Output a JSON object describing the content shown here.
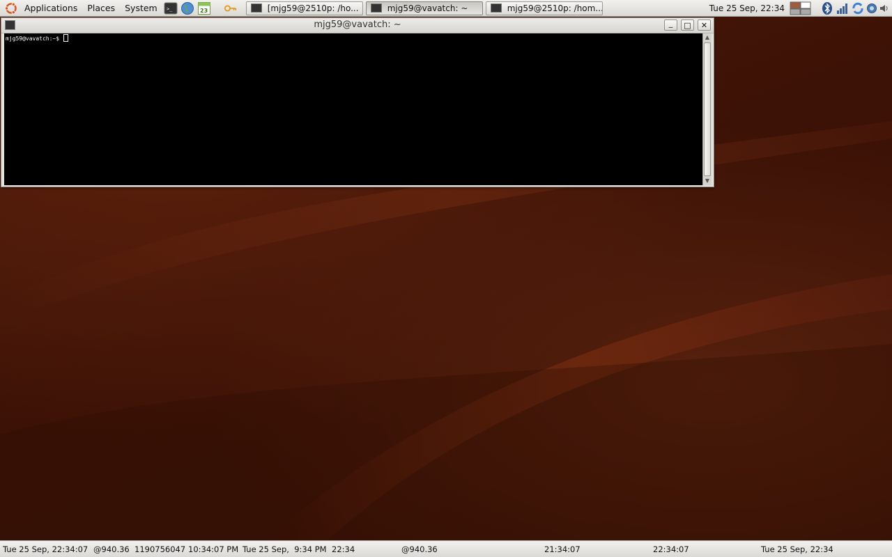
{
  "top_panel": {
    "menus": [
      "Applications",
      "Places",
      "System"
    ],
    "tasks": [
      {
        "label": "[mjg59@2510p: /ho...",
        "active": false
      },
      {
        "label": "mjg59@vavatch: ~",
        "active": true
      },
      {
        "label": "mjg59@2510p: /hom...",
        "active": false
      }
    ],
    "clock": "Tue 25 Sep, 22:34",
    "launcher_calendar_text": "23"
  },
  "terminal": {
    "title": "mjg59@vavatch: ~",
    "prompt": "mjg59@vavatch:~$ ",
    "buttons": {
      "minimize": "_",
      "maximize": "□",
      "close": "✕"
    }
  },
  "bottom_panel": {
    "clocks": [
      "Tue 25 Sep, 22:34:07",
      "@940.36",
      "1190756047",
      "10:34:07 PM",
      "Tue 25 Sep,  9:34 PM",
      "22:34",
      "@940.36",
      "21:34:07",
      "22:34:07",
      "Tue 25 Sep, 22:34"
    ]
  },
  "colors": {
    "wallpaper": "#3c1206",
    "terminal_bg": "#000000",
    "panel": "#e6e4e0"
  }
}
